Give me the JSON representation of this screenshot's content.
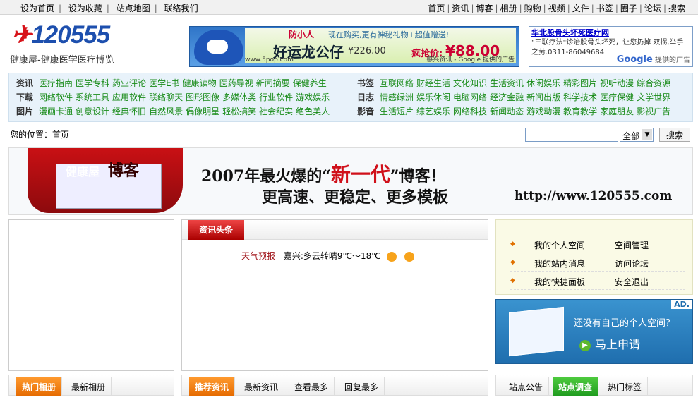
{
  "topbar": {
    "left": [
      "设为首页",
      "设为收藏",
      "站点地图",
      "联络我们"
    ],
    "right": [
      "首页",
      "资讯",
      "博客",
      "相册",
      "购物",
      "视频",
      "文件",
      "书签",
      "圈子",
      "论坛",
      "搜索"
    ]
  },
  "logo": {
    "text": "120555",
    "subtitle": "健康屋-健康医学医疗博览"
  },
  "ad_banner": {
    "brand_small": "防小人",
    "promo": "现在购买,更有神秘礼物+超值赠送!",
    "product": "好运龙公仔",
    "old_price": "¥226.00",
    "price_label": "疯抢价:",
    "price": "¥88.00",
    "site": "www.5pop.com",
    "google": "感兴资讯 - Google 提供的广告"
  },
  "text_ad": {
    "title": "华北股骨头坏死医疗网",
    "desc": "\"三联疗法\"诊治股骨头坏死，让您扔掉 双拐,举手之劳.0311-86049684",
    "provider": "Google",
    "provider_suffix": "提供的广告"
  },
  "nav": {
    "rows": [
      {
        "label": "资讯",
        "items": [
          "医疗指南",
          "医学专科",
          "药业评论",
          "医学E书",
          "健康读物",
          "医药导视",
          "新闻摘要",
          "保健养生"
        ]
      },
      {
        "label": "下载",
        "items": [
          "网络软件",
          "系统工具",
          "应用软件",
          "联络聊天",
          "图形图像",
          "多媒体类",
          "行业软件",
          "游戏娱乐"
        ]
      },
      {
        "label": "图片",
        "items": [
          "漫画卡通",
          "创意设计",
          "经典怀旧",
          "自然风景",
          "偶像明星",
          "轻松搞笑",
          "社会纪实",
          "绝色美人"
        ]
      }
    ],
    "rows2": [
      {
        "label": "书签",
        "items": [
          "互联网络",
          "财经生活",
          "文化知识",
          "生活资讯",
          "休闲娱乐",
          "精彩图片",
          "视听动漫",
          "综合资源"
        ]
      },
      {
        "label": "日志",
        "items": [
          "情感绿洲",
          "娱乐休闲",
          "电脑网络",
          "经济金融",
          "新闻出版",
          "科学技术",
          "医疗保健",
          "文学世界"
        ]
      },
      {
        "label": "影音",
        "items": [
          "生活短片",
          "综艺娱乐",
          "网络科技",
          "新闻动态",
          "游戏动漫",
          "教育教学",
          "家庭朋友",
          "影视广告"
        ]
      }
    ]
  },
  "crumb": {
    "label": "您的位置：",
    "home": "首页"
  },
  "search": {
    "select": "全部",
    "button": "搜索",
    "value": ""
  },
  "big_banner": {
    "logo_small": "健康屋",
    "logo_big": "博客",
    "line1_pre": "2007年最火爆的“",
    "line1_em": "新一代",
    "line1_post": "”博客！",
    "line2": "更高速、更稳定、更多模板",
    "url": "http://www.120555.com"
  },
  "news_head": {
    "tab": "资讯头条"
  },
  "weather": {
    "label": "天气预报",
    "text": "嘉兴:多云转晴9℃～18℃"
  },
  "user_panel": {
    "rows": [
      {
        "a": "我的个人空间",
        "b": "空间管理"
      },
      {
        "a": "我的站内消息",
        "b": "访问论坛"
      },
      {
        "a": "我的快捷面板",
        "b": "安全退出"
      }
    ]
  },
  "space_ad": {
    "tag": "AD.",
    "question": "还没有自己的个人空间？",
    "action": "马上申请"
  },
  "bottom_tabs": {
    "album": [
      "热门相册",
      "最新相册"
    ],
    "news": [
      "推荐资讯",
      "最新资讯",
      "查看最多",
      "回复最多"
    ],
    "site": [
      "站点公告",
      "站点调查",
      "热门标签"
    ]
  }
}
